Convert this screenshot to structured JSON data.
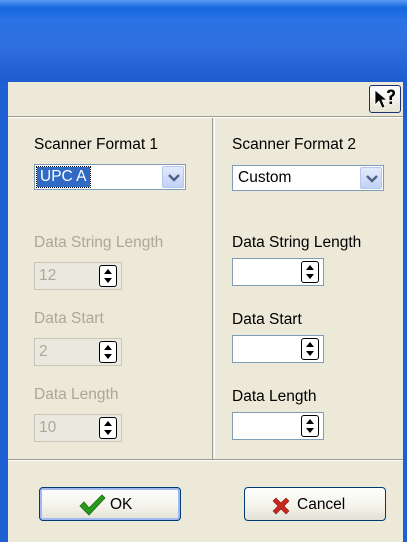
{
  "window": {
    "title": ""
  },
  "help_button": {
    "icon": "context-help-icon"
  },
  "left": {
    "title": "Scanner Format 1",
    "format": {
      "selected": "UPC A"
    },
    "fields": [
      {
        "label": "Data String Length",
        "value": "12"
      },
      {
        "label": "Data Start",
        "value": "2"
      },
      {
        "label": "Data Length",
        "value": "10"
      }
    ]
  },
  "right": {
    "title": "Scanner Format 2",
    "format": {
      "selected": "Custom"
    },
    "fields": [
      {
        "label": "Data String Length",
        "value": ""
      },
      {
        "label": "Data Start",
        "value": ""
      },
      {
        "label": "Data Length",
        "value": ""
      }
    ]
  },
  "buttons": {
    "ok": {
      "label": "OK",
      "icon": "checkmark-icon",
      "color": "#2a9a1c"
    },
    "cancel": {
      "label": "Cancel",
      "icon": "x-icon",
      "color": "#c8281e"
    }
  },
  "colors": {
    "title_bar": "#2b73e6",
    "dialog_bg": "#ece9d8",
    "disabled_text": "#aca899",
    "selection": "#316ac5"
  }
}
